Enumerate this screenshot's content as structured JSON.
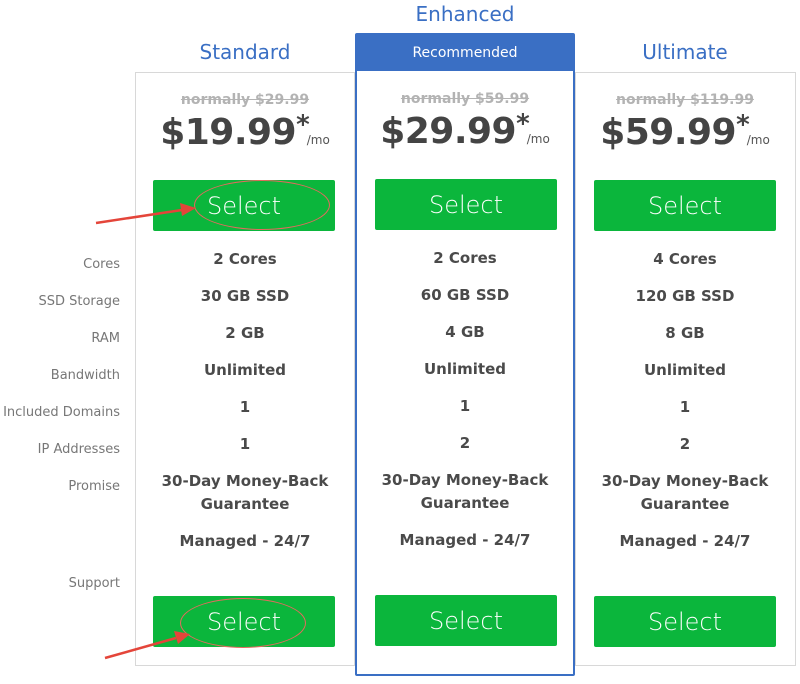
{
  "plans": [
    {
      "name": "Standard",
      "normal_price": "normally $29.99",
      "price": "$19.99",
      "star": "*",
      "per": "/mo",
      "select_label": "Select",
      "features": [
        "2 Cores",
        "30 GB SSD",
        "2 GB",
        "Unlimited",
        "1",
        "1",
        "30-Day Money-Back Guarantee",
        "Managed - 24/7"
      ]
    },
    {
      "name": "Enhanced",
      "badge": "Recommended",
      "normal_price": "normally $59.99",
      "price": "$29.99",
      "star": "*",
      "per": "/mo",
      "select_label": "Select",
      "features": [
        "2 Cores",
        "60 GB SSD",
        "4 GB",
        "Unlimited",
        "1",
        "2",
        "30-Day Money-Back Guarantee",
        "Managed - 24/7"
      ]
    },
    {
      "name": "Ultimate",
      "normal_price": "normally $119.99",
      "price": "$59.99",
      "star": "*",
      "per": "/mo",
      "select_label": "Select",
      "features": [
        "4 Cores",
        "120 GB SSD",
        "8 GB",
        "Unlimited",
        "1",
        "2",
        "30-Day Money-Back Guarantee",
        "Managed - 24/7"
      ]
    }
  ],
  "row_labels": [
    "Cores",
    "SSD Storage",
    "RAM",
    "Bandwidth",
    "Included Domains",
    "IP Addresses",
    "Promise",
    "Support"
  ],
  "colors": {
    "accent": "#3a6fc4",
    "button": "#0bb63c",
    "annotation": "#e4453a"
  }
}
